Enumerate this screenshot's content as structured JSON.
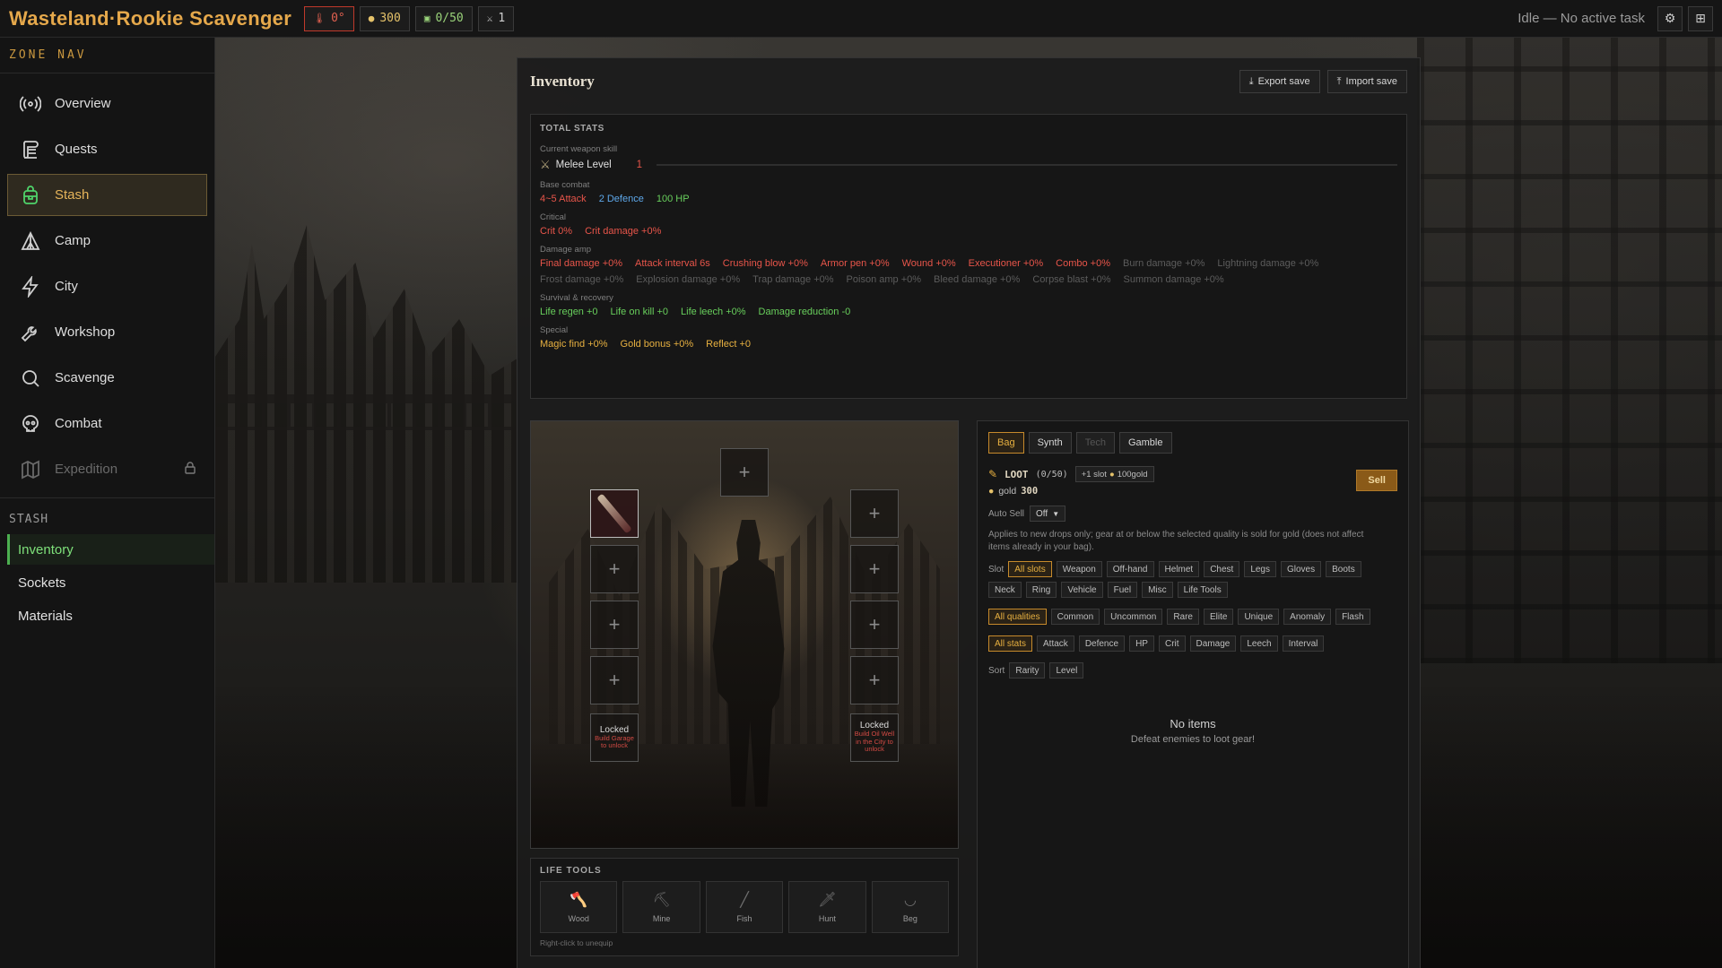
{
  "app": {
    "title": "Wasteland·Rookie Scavenger"
  },
  "topbar": {
    "temperature": "0°",
    "gold": "300",
    "bag": "0/50",
    "kills": "1",
    "status": "Idle — No active task"
  },
  "sidebar": {
    "zone_nav_title": "ZONE NAV",
    "items": [
      {
        "label": "Overview",
        "icon": "broadcast-icon"
      },
      {
        "label": "Quests",
        "icon": "scroll-icon"
      },
      {
        "label": "Stash",
        "icon": "backpack-icon"
      },
      {
        "label": "Camp",
        "icon": "tent-icon"
      },
      {
        "label": "City",
        "icon": "lightning-icon"
      },
      {
        "label": "Workshop",
        "icon": "wrench-icon"
      },
      {
        "label": "Scavenge",
        "icon": "search-icon"
      },
      {
        "label": "Combat",
        "icon": "skull-icon"
      },
      {
        "label": "Expedition",
        "icon": "map-icon"
      }
    ],
    "stash_title": "STASH",
    "stash_items": [
      "Inventory",
      "Sockets",
      "Materials"
    ]
  },
  "panel": {
    "title": "Inventory",
    "export_label": "Export save",
    "import_label": "Import save"
  },
  "stats": {
    "title": "TOTAL STATS",
    "weapon_skill_label": "Current weapon skill",
    "skill_name": "Melee Level",
    "skill_level": "1",
    "base_label": "Base combat",
    "attack": "4~5 Attack",
    "defence": "2 Defence",
    "hp": "100 HP",
    "critical_label": "Critical",
    "crit": "Crit 0%",
    "crit_damage": "Crit damage +0%",
    "damage_amp_label": "Damage amp",
    "amp_row1": [
      "Final damage +0%",
      "Attack interval 6s",
      "Crushing blow +0%",
      "Armor pen +0%",
      "Wound +0%",
      "Executioner +0%",
      "Combo +0%"
    ],
    "amp_row1_dim": [
      "Burn damage +0%",
      "Lightning damage +0%"
    ],
    "amp_row2_dim": [
      "Frost damage +0%",
      "Explosion damage +0%",
      "Trap damage +0%",
      "Poison amp +0%",
      "Bleed damage +0%",
      "Corpse blast +0%",
      "Summon damage +0%"
    ],
    "survival_label": "Survival & recovery",
    "survival": [
      "Life regen +0",
      "Life on kill +0",
      "Life leech +0%",
      "Damage reduction -0"
    ],
    "special_label": "Special",
    "special": [
      "Magic find +0%",
      "Gold bonus +0%",
      "Reflect +0"
    ]
  },
  "equipment": {
    "slot_plus": "+",
    "locked_left": {
      "label": "Locked",
      "reason": "Build Garage to unlock"
    },
    "locked_right": {
      "label": "Locked",
      "reason": "Build Oil Well in the City to unlock"
    }
  },
  "life_tools": {
    "title": "LIFE TOOLS",
    "tools": [
      {
        "label": "Wood",
        "icon": "axe-icon"
      },
      {
        "label": "Mine",
        "icon": "pickaxe-icon"
      },
      {
        "label": "Fish",
        "icon": "fishing-rod-icon"
      },
      {
        "label": "Hunt",
        "icon": "knife-icon"
      },
      {
        "label": "Beg",
        "icon": "bowl-icon"
      }
    ],
    "hint": "Right-click to unequip"
  },
  "loot": {
    "tabs": [
      "Bag",
      "Synth",
      "Tech",
      "Gamble"
    ],
    "name": "LOOT",
    "count": "(0/50)",
    "slot_button": "+1 slot",
    "slot_cost": "100gold",
    "gold_label": "gold",
    "gold_value": "300",
    "sell": "Sell",
    "auto_sell_label": "Auto Sell",
    "auto_sell_value": "Off",
    "help": "Applies to new drops only; gear at or below the selected quality is sold for gold (does not affect items already in your bag).",
    "slot_label": "Slot",
    "slots": [
      "All slots",
      "Weapon",
      "Off-hand",
      "Helmet",
      "Chest",
      "Legs",
      "Gloves",
      "Boots",
      "Neck",
      "Ring",
      "Vehicle",
      "Fuel",
      "Misc",
      "Life Tools"
    ],
    "qualities": [
      "All qualities",
      "Common",
      "Uncommon",
      "Rare",
      "Elite",
      "Unique",
      "Anomaly",
      "Flash"
    ],
    "stat_filters": [
      "All stats",
      "Attack",
      "Defence",
      "HP",
      "Crit",
      "Damage",
      "Leech",
      "Interval"
    ],
    "sort_label": "Sort",
    "sorts": [
      "Rarity",
      "Level"
    ],
    "empty_title": "No items",
    "empty_sub": "Defeat enemies to loot gear!"
  }
}
